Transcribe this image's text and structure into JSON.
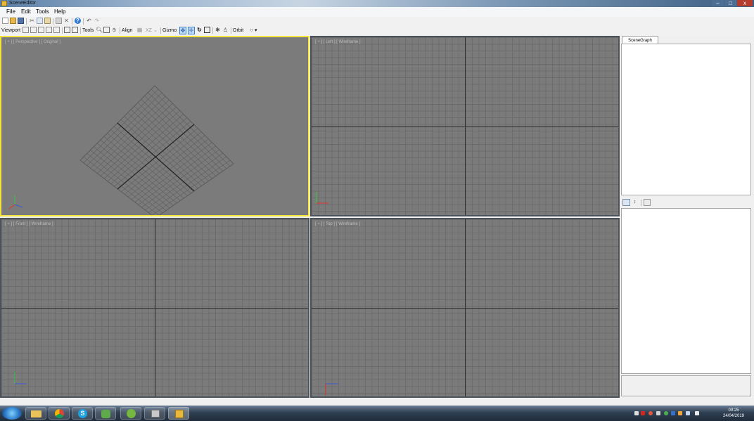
{
  "window": {
    "title": "SceneEditor",
    "controls": {
      "minimize": "–",
      "maximize": "□",
      "close": "x"
    }
  },
  "menu": {
    "items": [
      "File",
      "Edit",
      "Tools",
      "Help"
    ]
  },
  "toolbar2": {
    "viewport_label": "Viewport",
    "tools_label": "Tools",
    "align_label": "Align",
    "align_axis": "XZ",
    "gizmo_label": "Gizmo",
    "orbit_label": "Orbit"
  },
  "viewports": {
    "top_left": {
      "label": "[ + ] [ Perspective ] [ Original ]",
      "active": true
    },
    "top_right": {
      "label": "[ + ] [ Left ] [ Wireframe ]"
    },
    "bottom_left": {
      "label": "[ + ] [ Front ] [ Wireframe ]"
    },
    "bottom_right": {
      "label": "[ + ] [ Top ] [ Wireframe ]"
    }
  },
  "panels": {
    "scenegraph_tab": "SceneGraph"
  },
  "taskbar": {
    "clock_time": "00:25",
    "clock_date": "24/04/2019"
  },
  "colors": {
    "active_viewport_border": "#f3e43d",
    "viewport_bg": "#7b7b7b",
    "axis_x": "#e0352b",
    "axis_y": "#37c43d",
    "axis_z": "#3b5bd6"
  }
}
